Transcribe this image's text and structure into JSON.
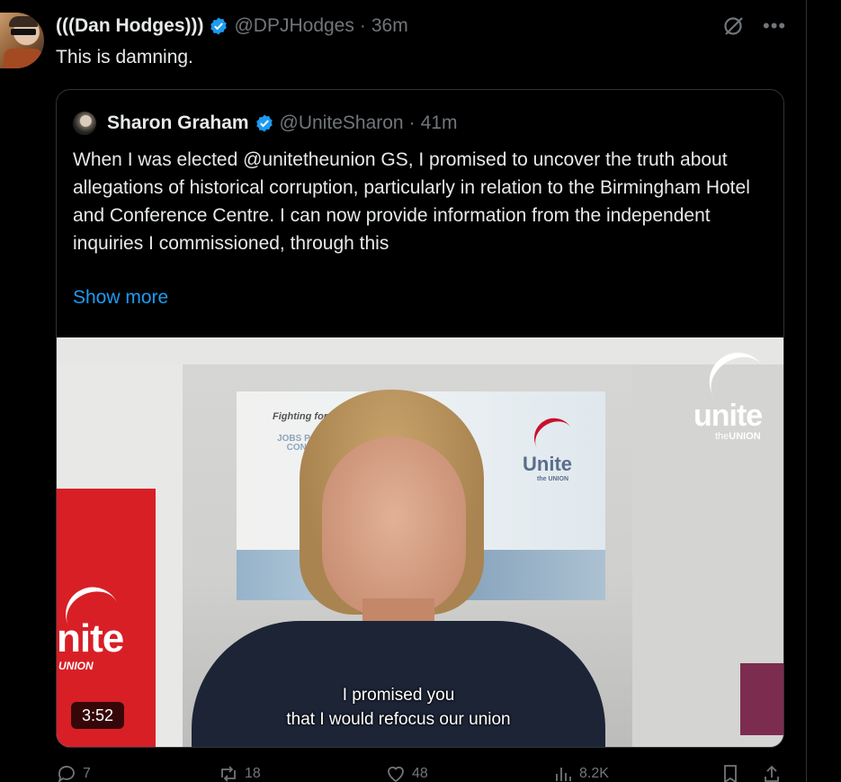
{
  "tweet": {
    "display_name": "(((Dan Hodges)))",
    "handle": "@DPJHodges",
    "separator": "·",
    "time": "36m",
    "text": "This is damning.",
    "more_icon": "more-dots-icon",
    "grok_icon": "grok-icon"
  },
  "quote": {
    "display_name": "Sharon Graham",
    "handle": "@UniteSharon",
    "separator": "·",
    "time": "41m",
    "text": "When I was elected @unitetheunion GS, I promised to uncover the truth about allegations of historical corruption, particularly in relation to the Birmingham Hotel and Conference Centre. I can now provide information from the independent inquiries I commissioned, through this",
    "show_more": "Show more",
    "video": {
      "duration": "3:52",
      "subtitle_line1": "I promised you",
      "subtitle_line2": "that I would refocus our union",
      "watermark": "unite",
      "watermark_sub_prefix": "the",
      "watermark_sub": "UNION",
      "poster_text": "Fighting for",
      "poster_words": "JOBS PAY CONDIT",
      "poster_logo": "Unite",
      "poster_logo_sub": "the UNION",
      "banner_text": "nite",
      "banner_sub": "UNION"
    }
  },
  "actions": {
    "replies": "7",
    "reposts": "18",
    "likes": "48",
    "views": "8.2K"
  },
  "colors": {
    "background": "#000000",
    "text": "#e7e9ea",
    "muted": "#71767b",
    "link": "#1d9bf0",
    "verified": "#1d9bf0",
    "border": "#2f3336"
  }
}
